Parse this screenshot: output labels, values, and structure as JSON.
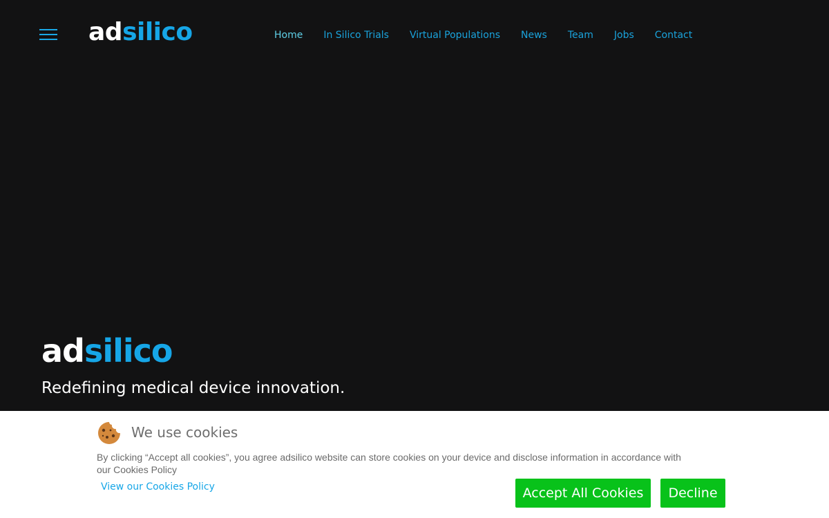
{
  "header": {
    "logo": {
      "part1": "ad",
      "part2": "silico"
    },
    "nav": [
      {
        "label": "Home",
        "active": true
      },
      {
        "label": "In Silico Trials"
      },
      {
        "label": "Virtual Populations"
      },
      {
        "label": "News"
      },
      {
        "label": "Team"
      },
      {
        "label": "Jobs"
      },
      {
        "label": "Contact"
      }
    ],
    "menu_icon": "hamburger-menu-icon"
  },
  "hero": {
    "logo": {
      "part1": "ad",
      "part2": "silico"
    },
    "tagline": "Redefining medical device innovation."
  },
  "cookies": {
    "icon": "cookie-icon",
    "title": "We use cookies",
    "text": "By clicking “Accept all cookies”, you agree adsilico website can store cookies on your device and disclose information in accordance with our Cookies Policy",
    "policy_link": "View our Cookies Policy",
    "accept_label": "Accept All Cookies",
    "decline_label": "Decline"
  },
  "colors": {
    "background": "#121213",
    "accent": "#16a6e7",
    "button": "#08c21a"
  }
}
